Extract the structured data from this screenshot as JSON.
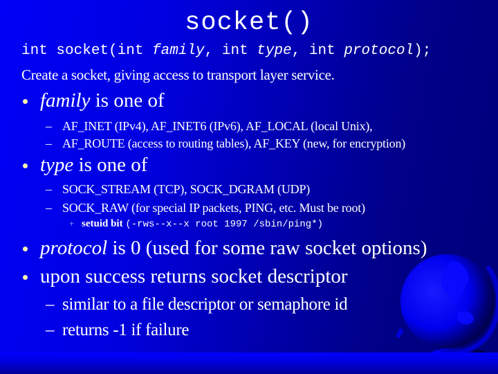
{
  "slide": {
    "title": "socket()",
    "prototype": {
      "p1": "int socket(int ",
      "a1": "family",
      "p2": ", int ",
      "a2": "type",
      "p3": ", int ",
      "a3": "protocol",
      "p4": ");"
    },
    "description": "Create a socket, giving access to transport layer service.",
    "bullets": [
      {
        "term": "family",
        "rest": " is one of",
        "subitems": [
          "AF_INET (IPv4), AF_INET6 (IPv6), AF_LOCAL (local Unix),",
          "AF_ROUTE (access to routing tables), AF_KEY (new, for encryption)"
        ]
      },
      {
        "term": "type",
        "rest": " is one of",
        "subitems": [
          "SOCK_STREAM (TCP), SOCK_DGRAM (UDP)",
          "SOCK_RAW (for special IP packets, PING, etc.  Must be root)"
        ],
        "subsub": {
          "label": "setuid bit",
          "code": "(-rws--x--x root 1997 /sbin/ping*)"
        }
      },
      {
        "term": "protocol",
        "rest": " is 0 (used for some raw socket options)"
      },
      {
        "text": "upon success returns socket descriptor",
        "subitems": [
          "similar to a file descriptor or semaphore id",
          "returns -1 if failure"
        ]
      }
    ],
    "dash_glyph": "–",
    "plus_glyph": "+",
    "decoration": "globe-icon",
    "colors": {
      "background_light": "#0000f6",
      "background_dark": "#000078",
      "text": "#ffffff",
      "bullet": "#fff3b0"
    }
  }
}
